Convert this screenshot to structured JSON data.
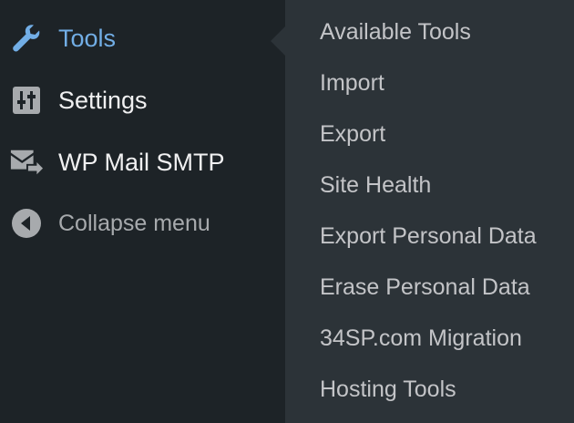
{
  "admin_menu": {
    "items": [
      {
        "label": "Tools",
        "icon": "wrench-icon",
        "active": true
      },
      {
        "label": "Settings",
        "icon": "sliders-icon"
      },
      {
        "label": "WP Mail SMTP",
        "icon": "mail-arrow-icon"
      },
      {
        "label": "Collapse menu",
        "icon": "collapse-arrow-icon"
      }
    ]
  },
  "submenu": {
    "items": [
      {
        "label": "Available Tools"
      },
      {
        "label": "Import"
      },
      {
        "label": "Export"
      },
      {
        "label": "Site Health"
      },
      {
        "label": "Export Personal Data"
      },
      {
        "label": "Erase Personal Data"
      },
      {
        "label": "34SP.com Migration"
      },
      {
        "label": "Hosting Tools"
      }
    ]
  },
  "colors": {
    "menu_background": "#1d2327",
    "submenu_background": "#2c3338",
    "active_text": "#72aee6",
    "menu_text": "#f0f0f1",
    "submenu_text": "#c3c4c7",
    "muted_text": "#a7aaad"
  }
}
